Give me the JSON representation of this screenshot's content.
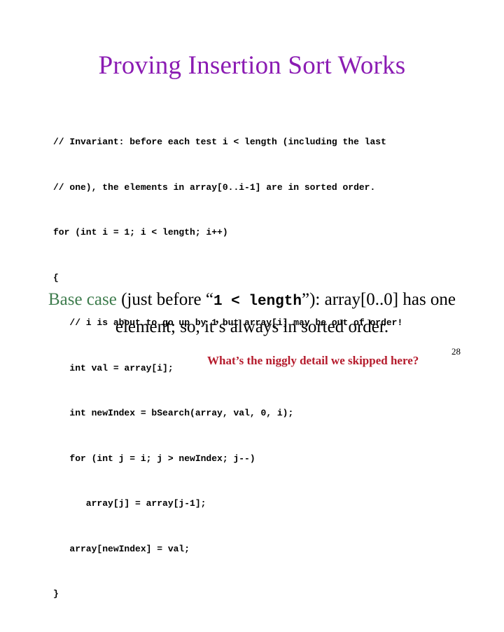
{
  "slide": {
    "title": "Proving Insertion Sort Works",
    "title_color": "#8B1CB3",
    "background_color": "#ffffff",
    "number": "28"
  },
  "code": {
    "language": "java",
    "lines": [
      "// Invariant: before each test i < length (including the last",
      "// one), the elements in array[0..i-1] are in sorted order.",
      "for (int i = 1; i < length; i++)",
      "{",
      "   // i is about to go up by 1 but array[i] may be out of order!",
      "   int val = array[i];",
      "   int newIndex = bSearch(array, val, 0, i);",
      "   for (int j = i; j > newIndex; j--)",
      "      array[j] = array[j-1];",
      "   array[newIndex] = val;",
      "}"
    ]
  },
  "base_case": {
    "label": "Base case",
    "label_color": "#3F7D4E",
    "text_before_code": " (just before “",
    "inline_code": "1 < length",
    "text_after_code": "”): array[0..0] has one element; so, it’s always in sorted order."
  },
  "question": {
    "text": "What’s the niggly detail we skipped here?",
    "color": "#B51B2C"
  }
}
